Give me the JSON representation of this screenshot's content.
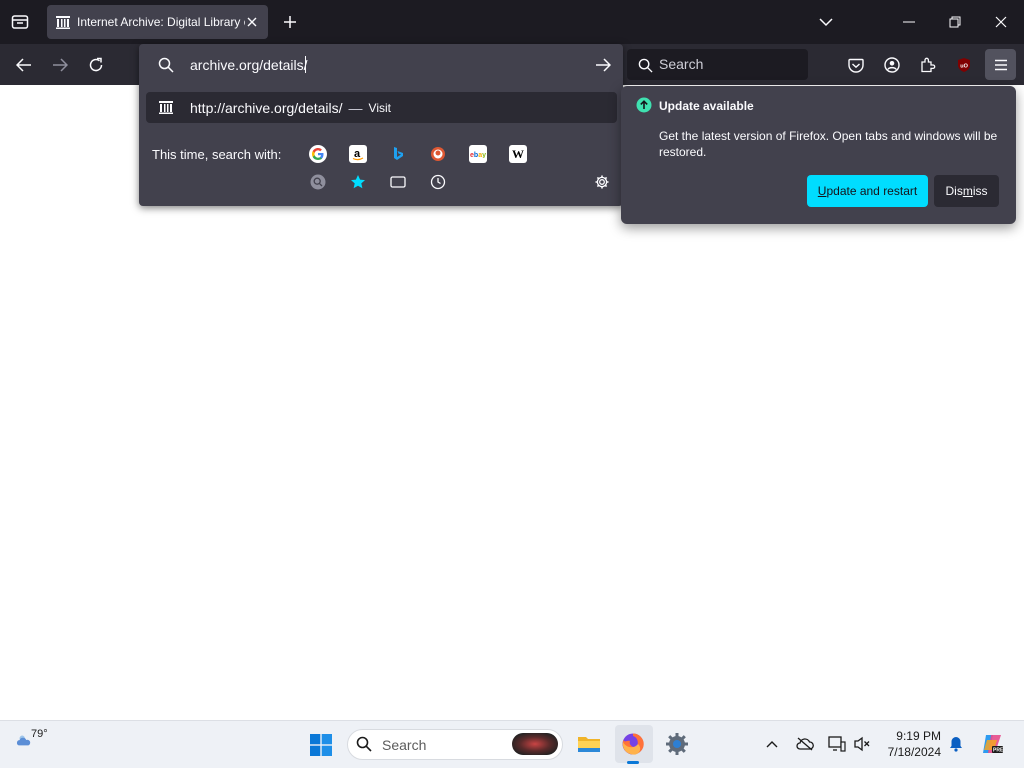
{
  "tab": {
    "title": "Internet Archive: Digital Library of Free & Borrowable Books"
  },
  "urlbar": {
    "value": "archive.org/details/"
  },
  "suggestion": {
    "url": "http://archive.org/details/",
    "separator": "—",
    "action": "Visit"
  },
  "search_with": {
    "label": "This time, search with:",
    "engines": [
      "google-icon",
      "amazon-icon",
      "bing-icon",
      "duckduckgo-icon",
      "ebay-icon",
      "wikipedia-icon",
      "history-search-icon",
      "bookmarks-icon",
      "tabs-icon",
      "history-icon"
    ]
  },
  "searchbox": {
    "placeholder": "Search"
  },
  "update_popup": {
    "title": "Update available",
    "body": "Get the latest version of Firefox. Open tabs and windows will be restored.",
    "update_label_pre": "U",
    "update_label_post": "pdate and restart",
    "dismiss_label_pre": "Dis",
    "dismiss_label_u": "m",
    "dismiss_label_post": "iss"
  },
  "taskbar": {
    "weather": "79°",
    "search_label": "Search",
    "time": "9:19 PM",
    "date": "7/18/2024"
  },
  "colors": {
    "accent": "#00ddff",
    "toolbar": "#2b2a33",
    "panel": "#42414d",
    "update_green": "#3fe1b0"
  }
}
